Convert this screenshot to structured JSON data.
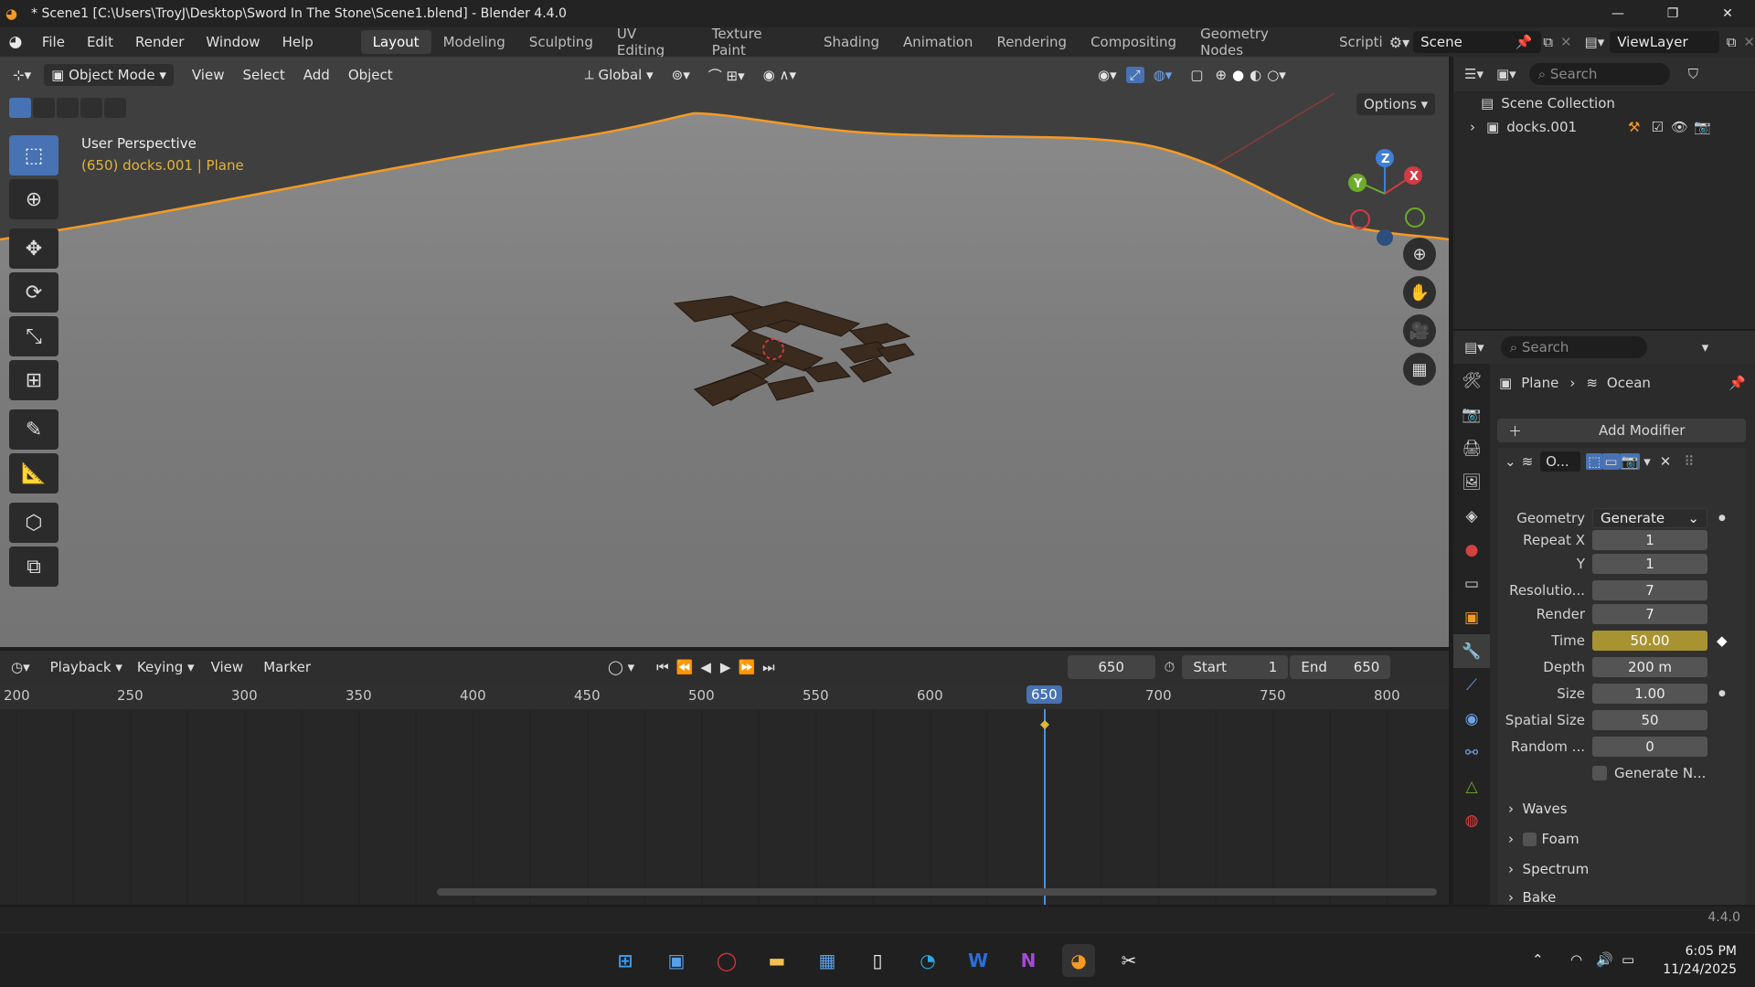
{
  "window": {
    "title": "* Scene1 [C:\\Users\\TroyJ\\Desktop\\Sword In The Stone\\Scene1.blend] - Blender 4.4.0",
    "min": "—",
    "restore": "❐",
    "close": "✕"
  },
  "menu": [
    "File",
    "Edit",
    "Render",
    "Window",
    "Help"
  ],
  "workspaces": [
    "Layout",
    "Modeling",
    "Sculpting",
    "UV Editing",
    "Texture Paint",
    "Shading",
    "Animation",
    "Rendering",
    "Compositing",
    "Geometry Nodes",
    "Scripti"
  ],
  "scene_name": "Scene",
  "view_layer": "ViewLayer",
  "viewport": {
    "mode": "Object Mode",
    "menus": [
      "View",
      "Select",
      "Add",
      "Object"
    ],
    "transform": "Global",
    "options": "Options",
    "perspective": "User Perspective",
    "object_info": "(650) docks.001 | Plane",
    "axis_x": "X",
    "axis_y": "Y",
    "axis_z": "Z"
  },
  "timeline": {
    "menus": [
      "Playback",
      "Keying",
      "View",
      "Marker"
    ],
    "current_frame": "650",
    "start_label": "Start",
    "start": "1",
    "end_label": "End",
    "end": "650",
    "ruler": [
      "200",
      "250",
      "300",
      "350",
      "400",
      "450",
      "500",
      "550",
      "600",
      "650",
      "700",
      "750",
      "800"
    ]
  },
  "outliner": {
    "search_placeholder": "Search",
    "collection": "Scene Collection",
    "item": "docks.001"
  },
  "properties": {
    "search_placeholder": "Search",
    "breadcrumb_object": "Plane",
    "breadcrumb_modifier": "Ocean",
    "add_modifier": "Add Modifier",
    "modifier_name": "O...",
    "fields": [
      {
        "label": "Geometry",
        "value": "Generate"
      },
      {
        "label": "Repeat X",
        "value": "1"
      },
      {
        "label": "Y",
        "value": "1"
      },
      {
        "label": "Resolutio...",
        "value": "7"
      },
      {
        "label": "Render",
        "value": "7"
      },
      {
        "label": "Time",
        "value": "50.00"
      },
      {
        "label": "Depth",
        "value": "200 m"
      },
      {
        "label": "Size",
        "value": "1.00"
      },
      {
        "label": "Spatial Size",
        "value": "50"
      },
      {
        "label": "Random ...",
        "value": "0"
      }
    ],
    "generate_normals": "Generate N...",
    "subpanels": [
      "Waves",
      "Foam",
      "Spectrum",
      "Bake"
    ]
  },
  "status": {
    "version": "4.4.0"
  },
  "taskbar": {
    "time": "6:05 PM",
    "date": "11/24/2025"
  },
  "colors": {
    "accent": "#4772b3",
    "keyframe": "#a89332",
    "selection_outline": "#f59a23",
    "playhead": "#4a8fe0"
  }
}
